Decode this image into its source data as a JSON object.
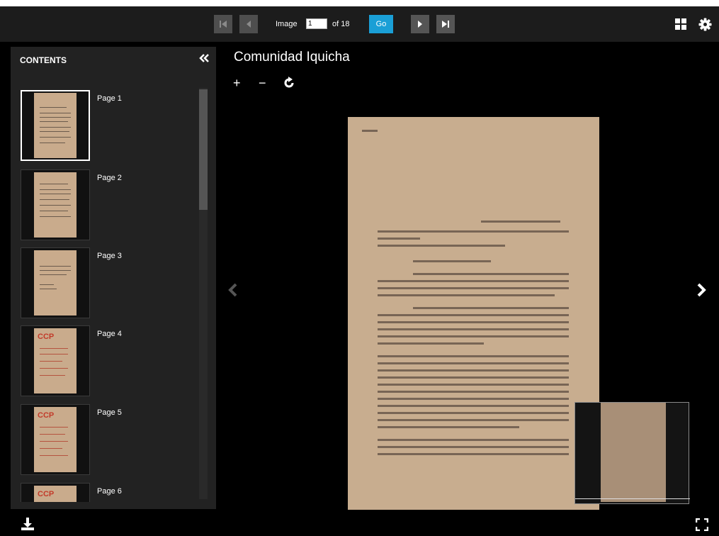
{
  "toolbar": {
    "image_label": "Image",
    "image_value": "1",
    "of_label": "of 18",
    "go_label": "Go"
  },
  "sidebar": {
    "title": "CONTENTS",
    "items": [
      {
        "label": "Page 1",
        "selected": true
      },
      {
        "label": "Page 2"
      },
      {
        "label": "Page 3"
      },
      {
        "label": "Page 4",
        "logo": "CCP"
      },
      {
        "label": "Page 5",
        "logo": "CCP"
      },
      {
        "label": "Page 6",
        "logo": "CCP"
      }
    ]
  },
  "viewer": {
    "title": "Comunidad Iquicha",
    "zoom_in": "+",
    "zoom_out": "−"
  },
  "colors": {
    "accent": "#1a9fd6",
    "paper": "#c8ad8f"
  }
}
